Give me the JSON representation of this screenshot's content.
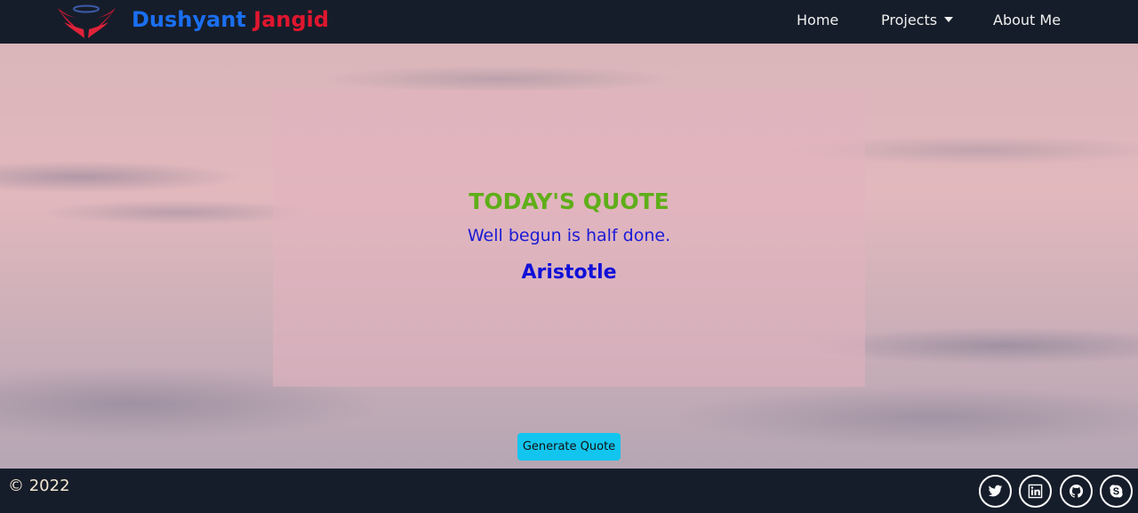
{
  "navbar": {
    "brand_first": "Dushyant",
    "brand_last": "Jangid",
    "logo_icon": "winged-halo-logo-icon",
    "items": [
      {
        "label": "Home"
      },
      {
        "label": "Projects",
        "has_dropdown": true
      },
      {
        "label": "About Me"
      }
    ],
    "colors": {
      "bg": "#161d2a",
      "brand_first": "#1a6ff0",
      "brand_last": "#e0162f"
    }
  },
  "quote": {
    "heading": "TODAY'S QUOTE",
    "text": "Well begun is half done.",
    "author": "Aristotle",
    "colors": {
      "heading": "#5fae19",
      "text": "#1b1bd6",
      "author": "#1010d8"
    }
  },
  "actions": {
    "generate_label": "Generate Quote",
    "generate_color": "#12c5ee"
  },
  "footer": {
    "copyright": "© 2022",
    "social_icons": [
      "twitter-icon",
      "linkedin-icon",
      "github-icon",
      "skype-icon"
    ]
  }
}
